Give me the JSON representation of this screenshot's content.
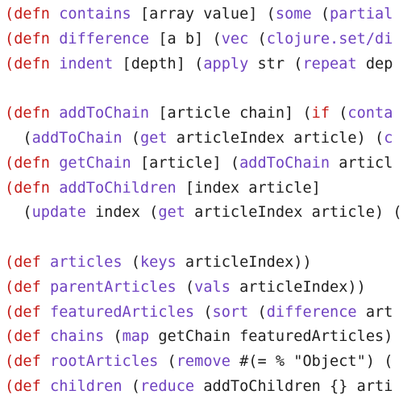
{
  "editor": {
    "language": "clojure",
    "colors": {
      "background": "#ffffff",
      "keyword": "#c41a16",
      "paren": "#c41a16",
      "symbol": "#6f42c1",
      "text": "#1f1f1f"
    },
    "lines": [
      {
        "tokens": [
          {
            "t": "paren",
            "v": "("
          },
          {
            "t": "kw",
            "v": "defn"
          },
          {
            "t": "plain",
            "v": " "
          },
          {
            "t": "fn",
            "v": "contains"
          },
          {
            "t": "plain",
            "v": " [array value] "
          },
          {
            "t": "plain",
            "v": "("
          },
          {
            "t": "fn",
            "v": "some"
          },
          {
            "t": "plain",
            "v": " ("
          },
          {
            "t": "fn",
            "v": "partial"
          }
        ]
      },
      {
        "tokens": [
          {
            "t": "paren",
            "v": "("
          },
          {
            "t": "kw",
            "v": "defn"
          },
          {
            "t": "plain",
            "v": " "
          },
          {
            "t": "fn",
            "v": "difference"
          },
          {
            "t": "plain",
            "v": " [a b] ("
          },
          {
            "t": "fn",
            "v": "vec"
          },
          {
            "t": "plain",
            "v": " ("
          },
          {
            "t": "fn",
            "v": "clojure.set/di"
          }
        ]
      },
      {
        "tokens": [
          {
            "t": "paren",
            "v": "("
          },
          {
            "t": "kw",
            "v": "defn"
          },
          {
            "t": "plain",
            "v": " "
          },
          {
            "t": "fn",
            "v": "indent"
          },
          {
            "t": "plain",
            "v": " [depth] ("
          },
          {
            "t": "fn",
            "v": "apply"
          },
          {
            "t": "plain",
            "v": " str ("
          },
          {
            "t": "fn",
            "v": "repeat"
          },
          {
            "t": "plain",
            "v": " dep"
          }
        ]
      },
      {
        "tokens": []
      },
      {
        "tokens": [
          {
            "t": "paren",
            "v": "("
          },
          {
            "t": "kw",
            "v": "defn"
          },
          {
            "t": "plain",
            "v": " "
          },
          {
            "t": "fn",
            "v": "addToChain"
          },
          {
            "t": "plain",
            "v": " [article chain] ("
          },
          {
            "t": "kw",
            "v": "if"
          },
          {
            "t": "plain",
            "v": " ("
          },
          {
            "t": "fn",
            "v": "conta"
          }
        ]
      },
      {
        "tokens": [
          {
            "t": "plain",
            "v": "  ("
          },
          {
            "t": "fn",
            "v": "addToChain"
          },
          {
            "t": "plain",
            "v": " ("
          },
          {
            "t": "fn",
            "v": "get"
          },
          {
            "t": "plain",
            "v": " articleIndex article) ("
          },
          {
            "t": "fn",
            "v": "c"
          }
        ]
      },
      {
        "tokens": [
          {
            "t": "paren",
            "v": "("
          },
          {
            "t": "kw",
            "v": "defn"
          },
          {
            "t": "plain",
            "v": " "
          },
          {
            "t": "fn",
            "v": "getChain"
          },
          {
            "t": "plain",
            "v": " [article] ("
          },
          {
            "t": "fn",
            "v": "addToChain"
          },
          {
            "t": "plain",
            "v": " articl"
          }
        ]
      },
      {
        "tokens": [
          {
            "t": "paren",
            "v": "("
          },
          {
            "t": "kw",
            "v": "defn"
          },
          {
            "t": "plain",
            "v": " "
          },
          {
            "t": "fn",
            "v": "addToChildren"
          },
          {
            "t": "plain",
            "v": " [index article]"
          }
        ]
      },
      {
        "tokens": [
          {
            "t": "plain",
            "v": "  ("
          },
          {
            "t": "fn",
            "v": "update"
          },
          {
            "t": "plain",
            "v": " index ("
          },
          {
            "t": "fn",
            "v": "get"
          },
          {
            "t": "plain",
            "v": " articleIndex article) "
          },
          {
            "t": "plain",
            "v": "("
          }
        ]
      },
      {
        "tokens": []
      },
      {
        "tokens": [
          {
            "t": "paren",
            "v": "("
          },
          {
            "t": "kw",
            "v": "def"
          },
          {
            "t": "plain",
            "v": " "
          },
          {
            "t": "fn",
            "v": "articles"
          },
          {
            "t": "plain",
            "v": " ("
          },
          {
            "t": "fn",
            "v": "keys"
          },
          {
            "t": "plain",
            "v": " articleIndex))"
          }
        ]
      },
      {
        "tokens": [
          {
            "t": "paren",
            "v": "("
          },
          {
            "t": "kw",
            "v": "def"
          },
          {
            "t": "plain",
            "v": " "
          },
          {
            "t": "fn",
            "v": "parentArticles"
          },
          {
            "t": "plain",
            "v": " ("
          },
          {
            "t": "fn",
            "v": "vals"
          },
          {
            "t": "plain",
            "v": " articleIndex))"
          }
        ]
      },
      {
        "tokens": [
          {
            "t": "paren",
            "v": "("
          },
          {
            "t": "kw",
            "v": "def"
          },
          {
            "t": "plain",
            "v": " "
          },
          {
            "t": "fn",
            "v": "featuredArticles"
          },
          {
            "t": "plain",
            "v": " ("
          },
          {
            "t": "fn",
            "v": "sort"
          },
          {
            "t": "plain",
            "v": " ("
          },
          {
            "t": "fn",
            "v": "difference"
          },
          {
            "t": "plain",
            "v": " art"
          }
        ]
      },
      {
        "tokens": [
          {
            "t": "paren",
            "v": "("
          },
          {
            "t": "kw",
            "v": "def"
          },
          {
            "t": "plain",
            "v": " "
          },
          {
            "t": "fn",
            "v": "chains"
          },
          {
            "t": "plain",
            "v": " ("
          },
          {
            "t": "fn",
            "v": "map"
          },
          {
            "t": "plain",
            "v": " getChain featuredArticles)"
          }
        ]
      },
      {
        "tokens": [
          {
            "t": "paren",
            "v": "("
          },
          {
            "t": "kw",
            "v": "def"
          },
          {
            "t": "plain",
            "v": " "
          },
          {
            "t": "fn",
            "v": "rootArticles"
          },
          {
            "t": "plain",
            "v": " ("
          },
          {
            "t": "fn",
            "v": "remove"
          },
          {
            "t": "plain",
            "v": " #(= % \"Object\") ("
          }
        ]
      },
      {
        "tokens": [
          {
            "t": "paren",
            "v": "("
          },
          {
            "t": "kw",
            "v": "def"
          },
          {
            "t": "plain",
            "v": " "
          },
          {
            "t": "fn",
            "v": "children"
          },
          {
            "t": "plain",
            "v": " ("
          },
          {
            "t": "fn",
            "v": "reduce"
          },
          {
            "t": "plain",
            "v": " addToChildren {} arti"
          }
        ]
      }
    ]
  }
}
